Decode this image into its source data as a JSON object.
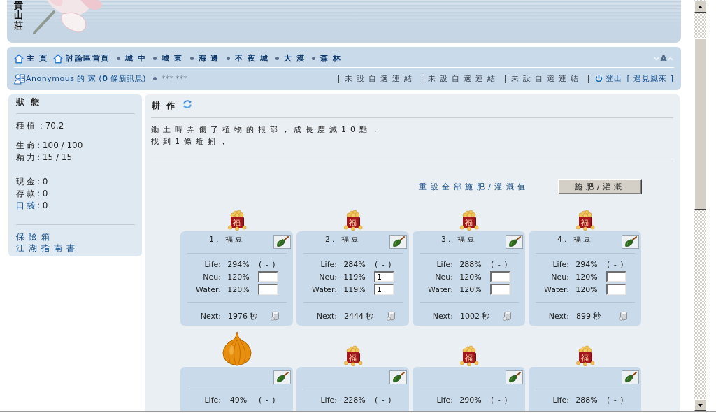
{
  "header": {
    "logo_text": "貴山莊"
  },
  "nav": {
    "links": [
      {
        "label": "主 頁",
        "kind": "home"
      },
      {
        "label": "討論區首頁",
        "kind": "home"
      },
      {
        "label": "城 中",
        "kind": "bullet"
      },
      {
        "label": "城 東",
        "kind": "bullet"
      },
      {
        "label": "海 邊",
        "kind": "bullet"
      },
      {
        "label": "不 夜 城",
        "kind": "bullet"
      },
      {
        "label": "大 漠",
        "kind": "bullet"
      },
      {
        "label": "森 林",
        "kind": "bullet"
      }
    ],
    "font_size_label": "A"
  },
  "user_bar": {
    "home_link": "Anonymous 的 家 (**0** 條新訊息)",
    "masked_name": "*** ***",
    "custom_links": [
      "未設自選連結",
      "未設自選連結",
      "未設自選連結"
    ],
    "logout": "登出",
    "profile_link": "[ 遇見風來 ]"
  },
  "sidebar": {
    "title": "狀態",
    "stat_groups": [
      [
        {
          "label": "種植",
          "value": " : 70.2",
          "link": false
        }
      ],
      [
        {
          "label": "生命",
          "value": ": 100 / 100",
          "link": false
        },
        {
          "label": "精力",
          "value": ": 15 / 15",
          "link": false
        }
      ],
      [
        {
          "label": "現金",
          "value": ": 0",
          "link": false
        },
        {
          "label": "存款",
          "value": ": 0",
          "link": false
        },
        {
          "label": "口袋",
          "value": ": 0",
          "link": true
        }
      ]
    ],
    "links": [
      "保險箱",
      "江湖指南書"
    ]
  },
  "farm": {
    "title": "耕作",
    "messages": [
      "鋤土時弄傷了植物的根部，成長度減10點，",
      "找到1條蚯蚓，"
    ],
    "reset_link": "重設全部施肥/灌溉值",
    "submit_button": "施肥/灌溉",
    "plots": [
      {
        "kind": "bean",
        "badge": "福",
        "title": "1. 福豆",
        "stats": [
          {
            "kind": "action",
            "label": "Life:",
            "value": "294%",
            "action": "( - )"
          },
          {
            "kind": "input",
            "label": "Neu:",
            "value": "120%"
          },
          {
            "kind": "input",
            "label": "Water:",
            "value": "120%"
          }
        ],
        "next_label": "Next:",
        "next_value": "1976 秒"
      },
      {
        "kind": "bean",
        "badge": "福",
        "title": "2. 福豆",
        "stats": [
          {
            "kind": "action",
            "label": "Life:",
            "value": "284%",
            "action": "( - )"
          },
          {
            "kind": "input",
            "label": "Neu:",
            "value": "119%",
            "entered": "1"
          },
          {
            "kind": "input",
            "label": "Water:",
            "value": "119%",
            "entered": "1"
          }
        ],
        "next_label": "Next:",
        "next_value": "2444 秒"
      },
      {
        "kind": "bean",
        "badge": "福",
        "title": "3. 福豆",
        "stats": [
          {
            "kind": "action",
            "label": "Life:",
            "value": "288%",
            "action": "( - )"
          },
          {
            "kind": "input",
            "label": "Neu:",
            "value": "120%"
          },
          {
            "kind": "input",
            "label": "Water:",
            "value": "120%"
          }
        ],
        "next_label": "Next:",
        "next_value": "1002 秒"
      },
      {
        "kind": "bean",
        "badge": "福",
        "title": "4. 福豆",
        "stats": [
          {
            "kind": "action",
            "label": "Life:",
            "value": "294%",
            "action": "( - )"
          },
          {
            "kind": "input",
            "label": "Neu:",
            "value": "120%"
          },
          {
            "kind": "input",
            "label": "Water:",
            "value": "120%"
          }
        ],
        "next_label": "Next:",
        "next_value": "899 秒"
      },
      {
        "kind": "onion",
        "stats": [
          {
            "kind": "action",
            "label": "Life:",
            "value": "49%",
            "action": "( - )"
          }
        ]
      },
      {
        "kind": "bean",
        "badge": "福",
        "stats": [
          {
            "kind": "action",
            "label": "Life:",
            "value": "228%",
            "action": "( - )"
          }
        ]
      },
      {
        "kind": "bean",
        "badge": "福",
        "stats": [
          {
            "kind": "action",
            "label": "Life:",
            "value": "290%",
            "action": "( - )"
          }
        ]
      },
      {
        "kind": "bean",
        "badge": "福",
        "stats": [
          {
            "kind": "action",
            "label": "Life:",
            "value": "288%",
            "action": "( - )"
          }
        ]
      }
    ]
  }
}
